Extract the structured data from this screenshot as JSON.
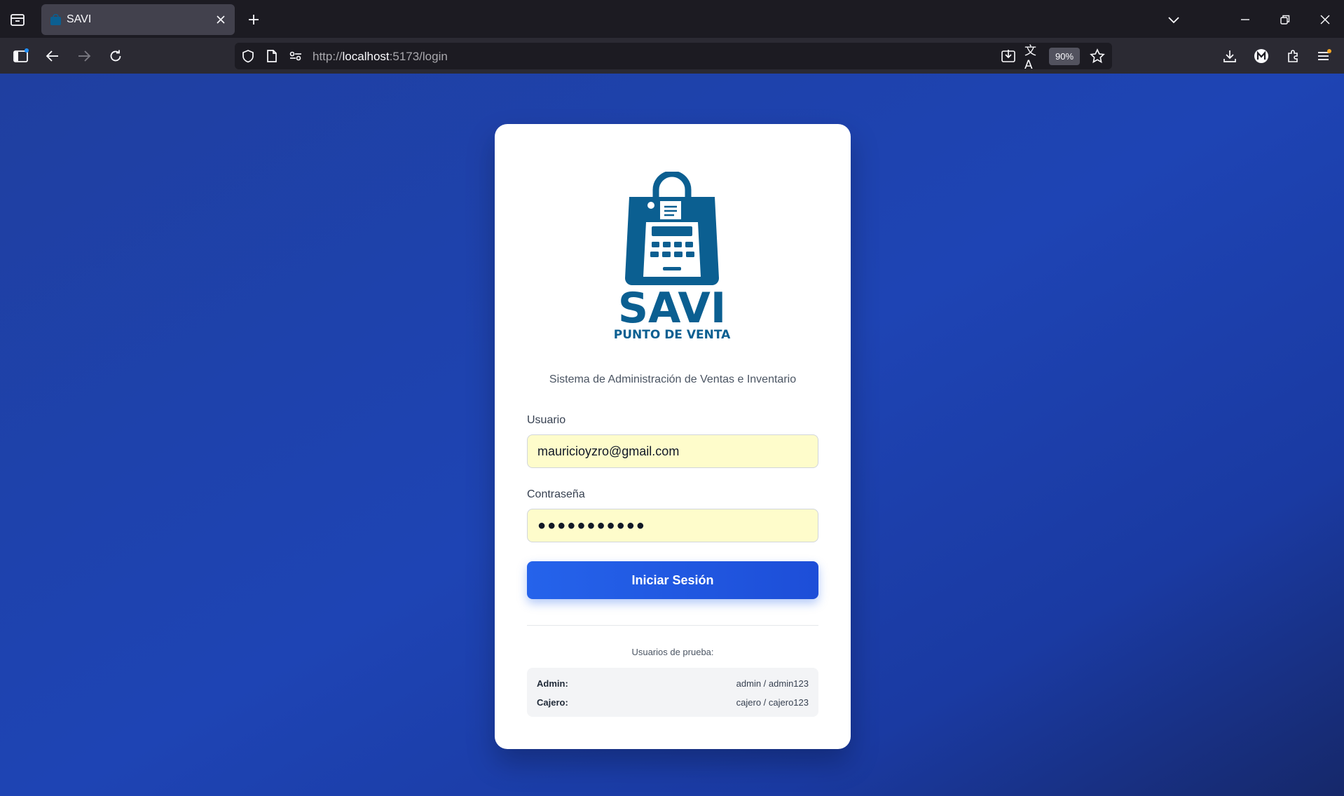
{
  "browser": {
    "tab": {
      "title": "SAVI"
    },
    "url": {
      "scheme": "http://",
      "host": "localhost",
      "rest": ":5173/login"
    },
    "zoom": "90%"
  },
  "logo": {
    "brand": "SAVI",
    "tagline": "PUNTO DE VENTA"
  },
  "login": {
    "subtitle": "Sistema de Administración de Ventas e Inventario",
    "username_label": "Usuario",
    "username_value": "mauricioyzro@gmail.com",
    "password_label": "Contraseña",
    "password_value": "●●●●●●●●●●●",
    "submit_label": "Iniciar Sesión"
  },
  "test_users": {
    "title": "Usuarios de prueba:",
    "rows": [
      {
        "role": "Admin:",
        "credentials": "admin / admin123"
      },
      {
        "role": "Cajero:",
        "credentials": "cajero / cajero123"
      }
    ]
  },
  "colors": {
    "brand_blue": "#0b5f91",
    "button_blue": "#2563eb",
    "page_background": "#1e44b4",
    "autofill_yellow": "#fefccb"
  }
}
